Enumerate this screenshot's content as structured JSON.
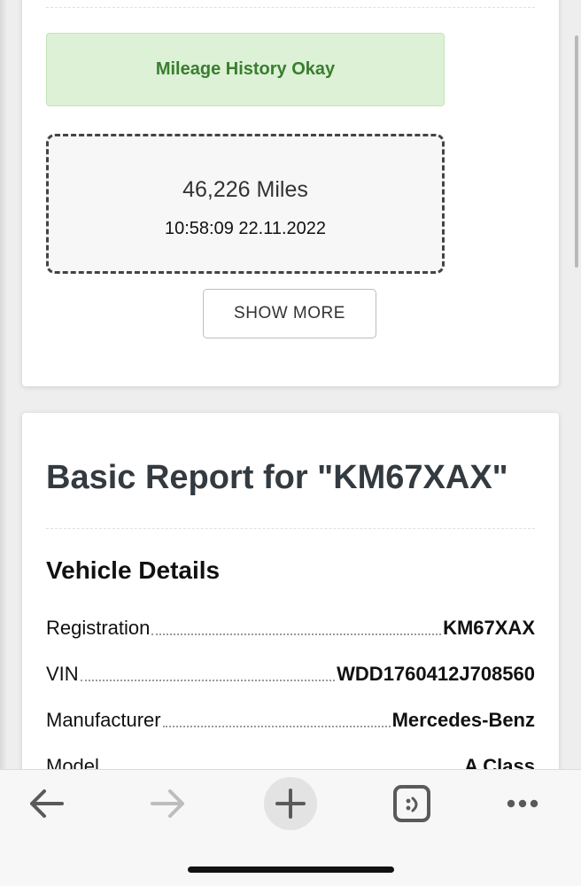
{
  "mileage_card": {
    "status_text": "Mileage History Okay",
    "status_color": "#3a7d2f",
    "mileage": "46,226 Miles",
    "timestamp": "10:58:09 22.11.2022",
    "show_more_label": "SHOW MORE"
  },
  "report": {
    "title": "Basic Report for \"KM67XAX\"",
    "section_title": "Vehicle Details",
    "rows": [
      {
        "label": "Registration",
        "value": "KM67XAX"
      },
      {
        "label": "VIN",
        "value": "WDD1760412J708560"
      },
      {
        "label": "Manufacturer",
        "value": "Mercedes-Benz"
      },
      {
        "label": "Model",
        "value": "A Class"
      }
    ]
  },
  "toolbar": {
    "icons": [
      "back-arrow-icon",
      "forward-arrow-icon",
      "new-tab-plus-icon",
      "tabs-icon",
      "more-options-icon"
    ]
  }
}
